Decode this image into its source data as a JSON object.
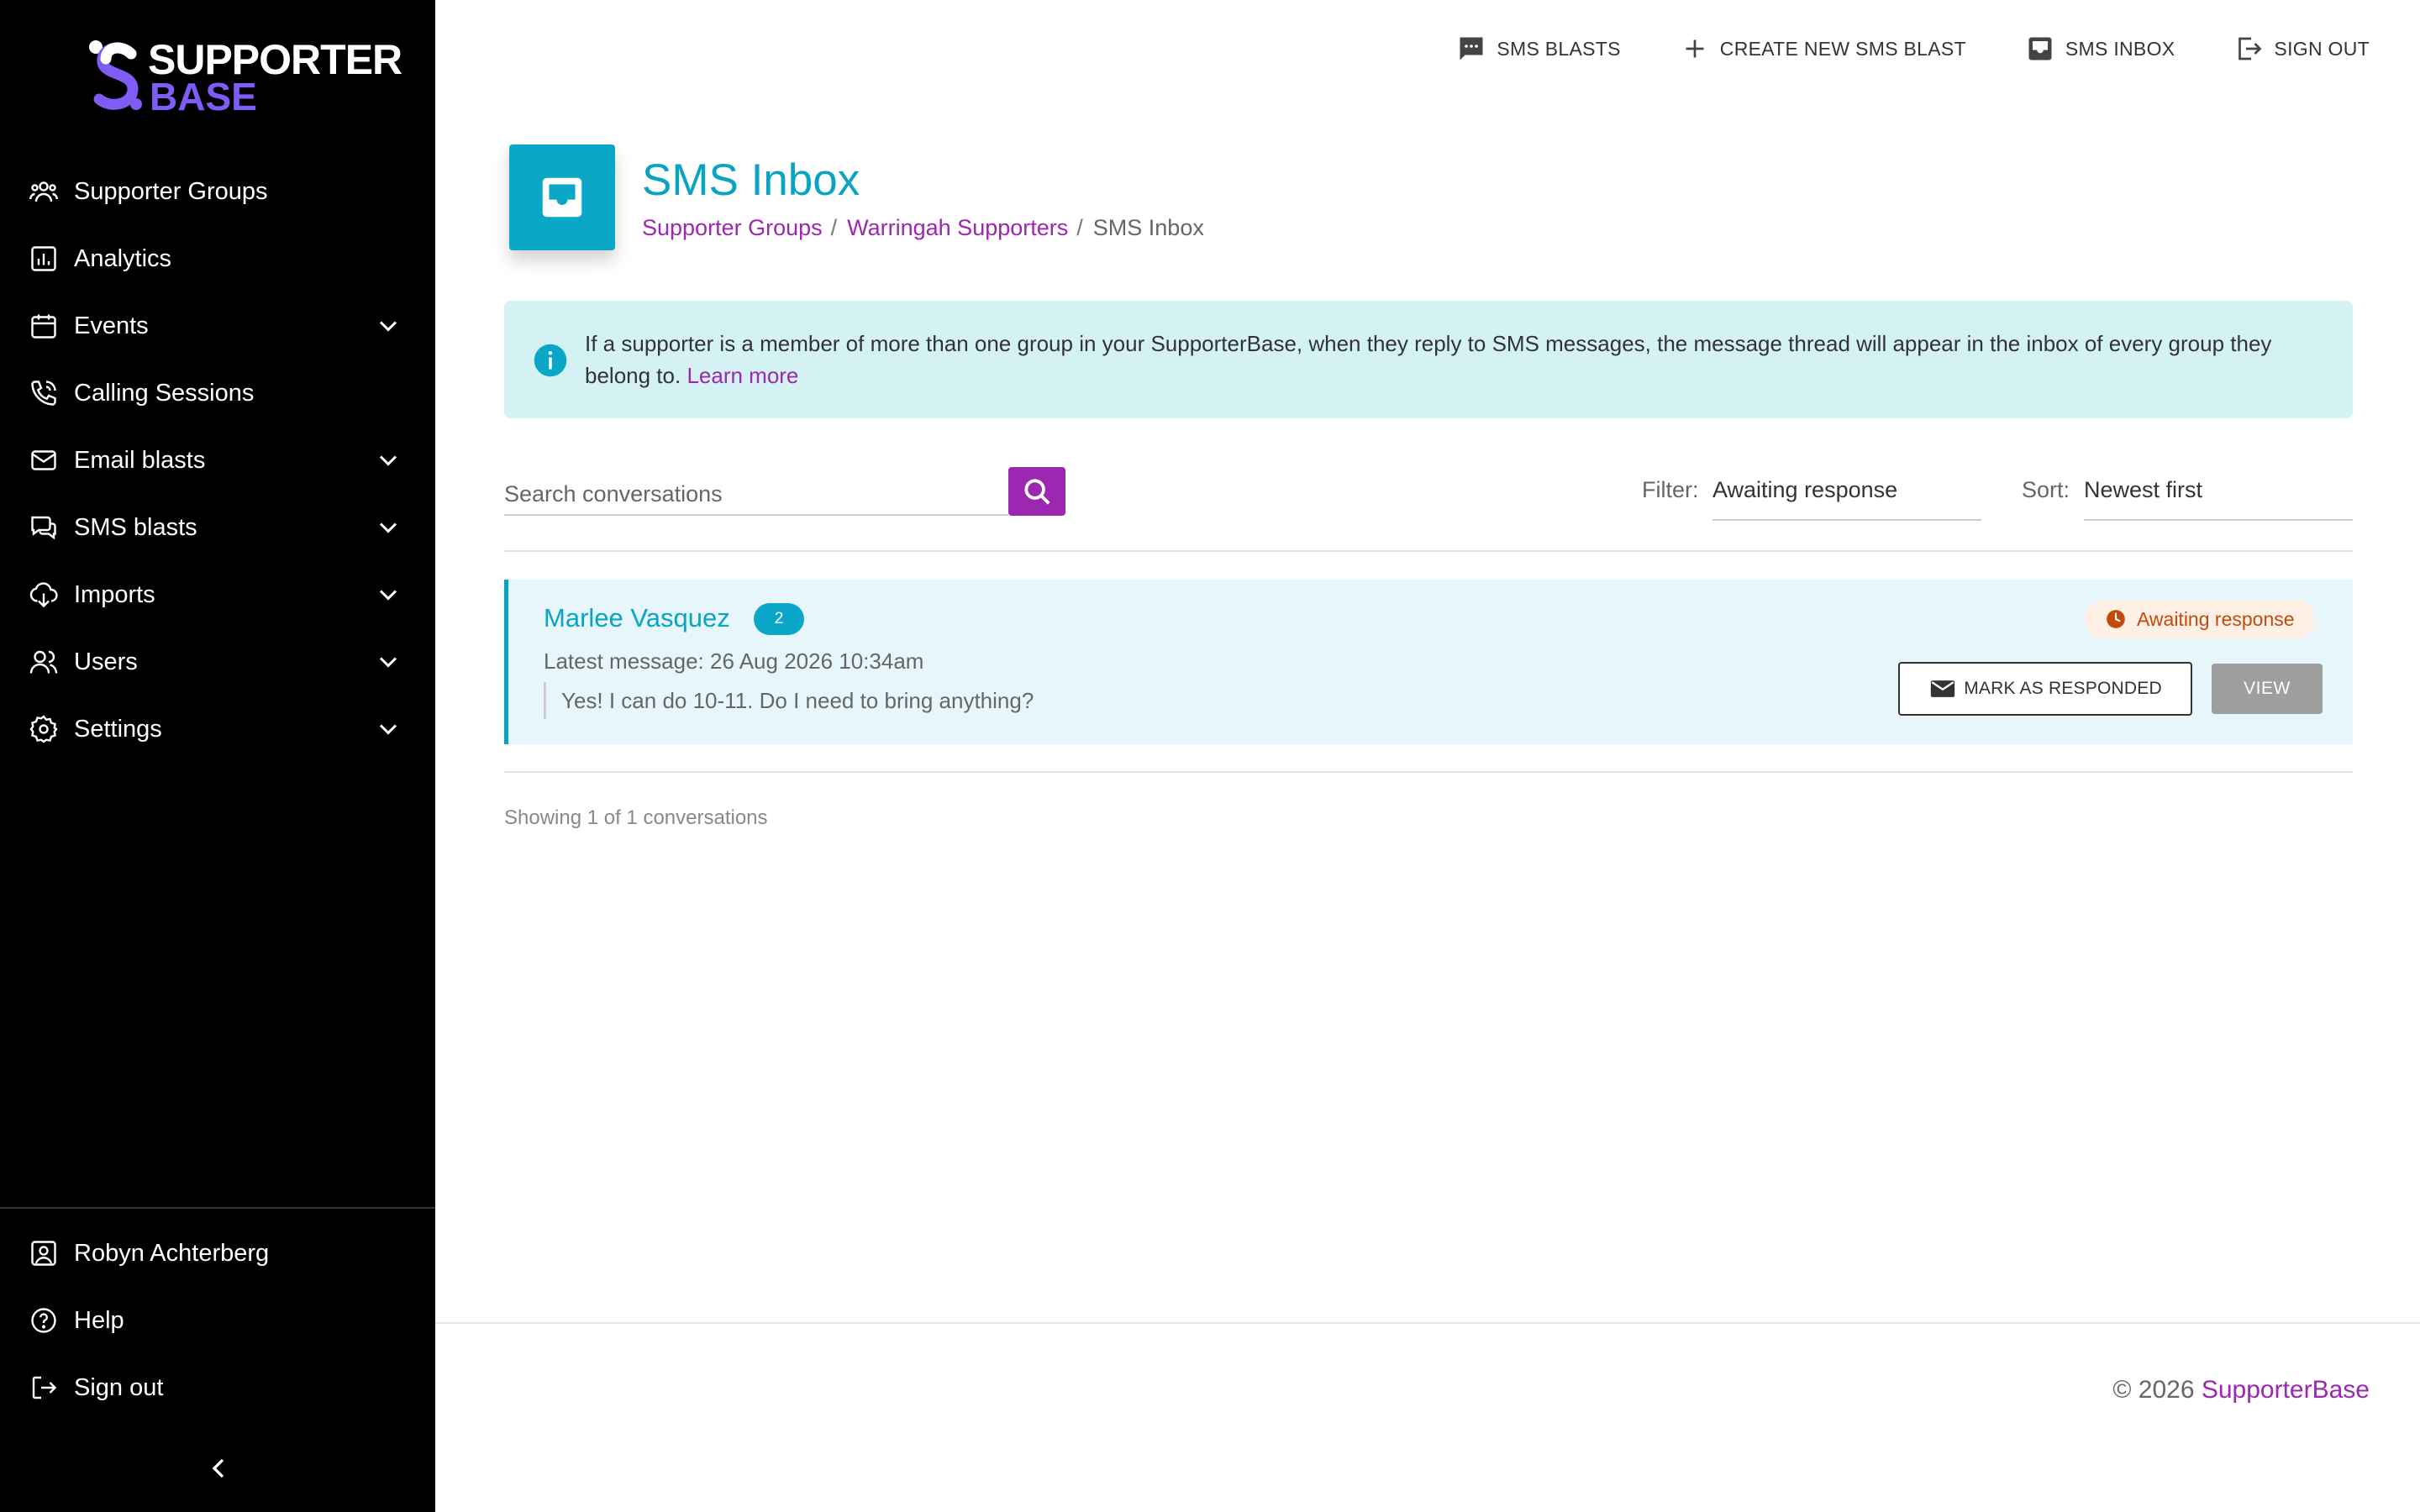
{
  "brand": {
    "logo_line1": "SUPPORTER",
    "logo_line2": "BASE",
    "accent_purple": "#9c27b0",
    "accent_teal": "#0aa7c8"
  },
  "sidebar": {
    "items": [
      {
        "label": "Supporter Groups",
        "icon": "people-group-icon",
        "expandable": false
      },
      {
        "label": "Analytics",
        "icon": "bar-chart-icon",
        "expandable": false
      },
      {
        "label": "Events",
        "icon": "calendar-icon",
        "expandable": true
      },
      {
        "label": "Calling Sessions",
        "icon": "phone-icon",
        "expandable": false
      },
      {
        "label": "Email blasts",
        "icon": "mail-icon",
        "expandable": true
      },
      {
        "label": "SMS blasts",
        "icon": "chat-bubbles-icon",
        "expandable": true
      },
      {
        "label": "Imports",
        "icon": "download-icon",
        "expandable": true
      },
      {
        "label": "Users",
        "icon": "users-icon",
        "expandable": true
      },
      {
        "label": "Settings",
        "icon": "gear-icon",
        "expandable": true
      }
    ],
    "bottom_items": [
      {
        "label": "Robyn Achterberg",
        "icon": "account-box-icon"
      },
      {
        "label": "Help",
        "icon": "help-circle-icon"
      },
      {
        "label": "Sign out",
        "icon": "logout-icon"
      }
    ]
  },
  "topbar": {
    "sms_blasts": "SMS BLASTS",
    "create_new": "CREATE NEW SMS BLAST",
    "sms_inbox": "SMS INBOX",
    "sign_out": "SIGN OUT"
  },
  "header": {
    "title": "SMS Inbox",
    "breadcrumb": [
      "Supporter Groups",
      "Warringah Supporters",
      "SMS Inbox"
    ],
    "breadcrumb_sep": "/"
  },
  "alert": {
    "text": "If a supporter is a member of more than one group in your SupporterBase, when they reply to SMS messages, the message thread will appear in the inbox of every group they belong to. ",
    "link": "Learn more"
  },
  "search": {
    "placeholder": "Search conversations",
    "value": ""
  },
  "filter": {
    "label": "Filter:",
    "value": "Awaiting response"
  },
  "sort": {
    "label": "Sort:",
    "value": "Newest first"
  },
  "conversations": [
    {
      "name": "Marlee Vasquez",
      "count": "2",
      "latest": "Latest message: 26 Aug 2026 10:34am",
      "preview": "Yes! I can do 10-11. Do I need to bring anything?",
      "status": "Awaiting response",
      "mark_label": "MARK AS RESPONDED",
      "view_label": "VIEW"
    }
  ],
  "showing": "Showing 1 of 1 conversations",
  "footer": {
    "copyright": "© 2026 ",
    "brand": "SupporterBase"
  }
}
